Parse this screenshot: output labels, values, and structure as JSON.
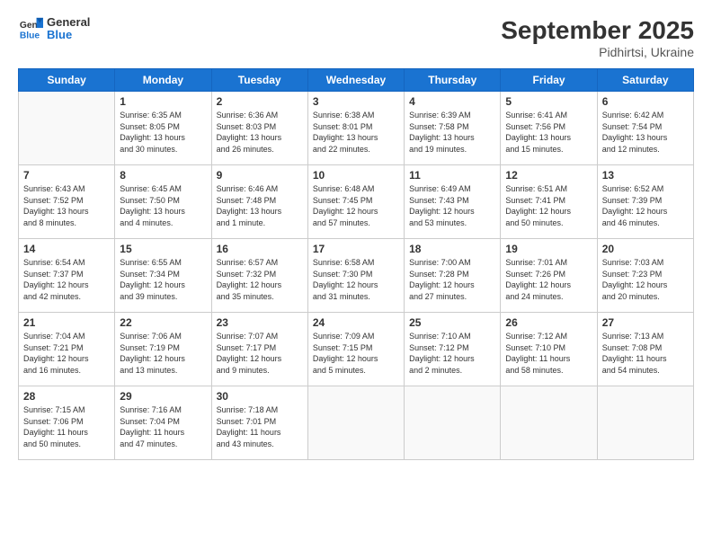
{
  "app": {
    "name_general": "General",
    "name_blue": "Blue",
    "title": "September 2025",
    "subtitle": "Pidhirtsi, Ukraine"
  },
  "calendar": {
    "headers": [
      "Sunday",
      "Monday",
      "Tuesday",
      "Wednesday",
      "Thursday",
      "Friday",
      "Saturday"
    ],
    "weeks": [
      [
        {
          "day": "",
          "info": ""
        },
        {
          "day": "1",
          "info": "Sunrise: 6:35 AM\nSunset: 8:05 PM\nDaylight: 13 hours\nand 30 minutes."
        },
        {
          "day": "2",
          "info": "Sunrise: 6:36 AM\nSunset: 8:03 PM\nDaylight: 13 hours\nand 26 minutes."
        },
        {
          "day": "3",
          "info": "Sunrise: 6:38 AM\nSunset: 8:01 PM\nDaylight: 13 hours\nand 22 minutes."
        },
        {
          "day": "4",
          "info": "Sunrise: 6:39 AM\nSunset: 7:58 PM\nDaylight: 13 hours\nand 19 minutes."
        },
        {
          "day": "5",
          "info": "Sunrise: 6:41 AM\nSunset: 7:56 PM\nDaylight: 13 hours\nand 15 minutes."
        },
        {
          "day": "6",
          "info": "Sunrise: 6:42 AM\nSunset: 7:54 PM\nDaylight: 13 hours\nand 12 minutes."
        }
      ],
      [
        {
          "day": "7",
          "info": "Sunrise: 6:43 AM\nSunset: 7:52 PM\nDaylight: 13 hours\nand 8 minutes."
        },
        {
          "day": "8",
          "info": "Sunrise: 6:45 AM\nSunset: 7:50 PM\nDaylight: 13 hours\nand 4 minutes."
        },
        {
          "day": "9",
          "info": "Sunrise: 6:46 AM\nSunset: 7:48 PM\nDaylight: 13 hours\nand 1 minute."
        },
        {
          "day": "10",
          "info": "Sunrise: 6:48 AM\nSunset: 7:45 PM\nDaylight: 12 hours\nand 57 minutes."
        },
        {
          "day": "11",
          "info": "Sunrise: 6:49 AM\nSunset: 7:43 PM\nDaylight: 12 hours\nand 53 minutes."
        },
        {
          "day": "12",
          "info": "Sunrise: 6:51 AM\nSunset: 7:41 PM\nDaylight: 12 hours\nand 50 minutes."
        },
        {
          "day": "13",
          "info": "Sunrise: 6:52 AM\nSunset: 7:39 PM\nDaylight: 12 hours\nand 46 minutes."
        }
      ],
      [
        {
          "day": "14",
          "info": "Sunrise: 6:54 AM\nSunset: 7:37 PM\nDaylight: 12 hours\nand 42 minutes."
        },
        {
          "day": "15",
          "info": "Sunrise: 6:55 AM\nSunset: 7:34 PM\nDaylight: 12 hours\nand 39 minutes."
        },
        {
          "day": "16",
          "info": "Sunrise: 6:57 AM\nSunset: 7:32 PM\nDaylight: 12 hours\nand 35 minutes."
        },
        {
          "day": "17",
          "info": "Sunrise: 6:58 AM\nSunset: 7:30 PM\nDaylight: 12 hours\nand 31 minutes."
        },
        {
          "day": "18",
          "info": "Sunrise: 7:00 AM\nSunset: 7:28 PM\nDaylight: 12 hours\nand 27 minutes."
        },
        {
          "day": "19",
          "info": "Sunrise: 7:01 AM\nSunset: 7:26 PM\nDaylight: 12 hours\nand 24 minutes."
        },
        {
          "day": "20",
          "info": "Sunrise: 7:03 AM\nSunset: 7:23 PM\nDaylight: 12 hours\nand 20 minutes."
        }
      ],
      [
        {
          "day": "21",
          "info": "Sunrise: 7:04 AM\nSunset: 7:21 PM\nDaylight: 12 hours\nand 16 minutes."
        },
        {
          "day": "22",
          "info": "Sunrise: 7:06 AM\nSunset: 7:19 PM\nDaylight: 12 hours\nand 13 minutes."
        },
        {
          "day": "23",
          "info": "Sunrise: 7:07 AM\nSunset: 7:17 PM\nDaylight: 12 hours\nand 9 minutes."
        },
        {
          "day": "24",
          "info": "Sunrise: 7:09 AM\nSunset: 7:15 PM\nDaylight: 12 hours\nand 5 minutes."
        },
        {
          "day": "25",
          "info": "Sunrise: 7:10 AM\nSunset: 7:12 PM\nDaylight: 12 hours\nand 2 minutes."
        },
        {
          "day": "26",
          "info": "Sunrise: 7:12 AM\nSunset: 7:10 PM\nDaylight: 11 hours\nand 58 minutes."
        },
        {
          "day": "27",
          "info": "Sunrise: 7:13 AM\nSunset: 7:08 PM\nDaylight: 11 hours\nand 54 minutes."
        }
      ],
      [
        {
          "day": "28",
          "info": "Sunrise: 7:15 AM\nSunset: 7:06 PM\nDaylight: 11 hours\nand 50 minutes."
        },
        {
          "day": "29",
          "info": "Sunrise: 7:16 AM\nSunset: 7:04 PM\nDaylight: 11 hours\nand 47 minutes."
        },
        {
          "day": "30",
          "info": "Sunrise: 7:18 AM\nSunset: 7:01 PM\nDaylight: 11 hours\nand 43 minutes."
        },
        {
          "day": "",
          "info": ""
        },
        {
          "day": "",
          "info": ""
        },
        {
          "day": "",
          "info": ""
        },
        {
          "day": "",
          "info": ""
        }
      ]
    ]
  }
}
